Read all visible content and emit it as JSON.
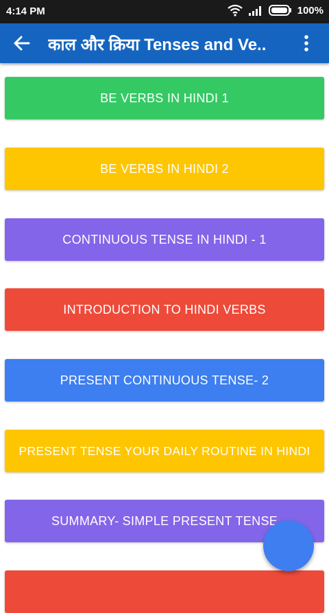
{
  "status": {
    "time": "4:14 PM",
    "battery": "100%"
  },
  "toolbar": {
    "title": "काल और क्रिया Tenses and Ve.."
  },
  "buttons": [
    {
      "label": "BE VERBS IN HINDI 1",
      "color": "#35c964"
    },
    {
      "label": "BE VERBS IN HINDI 2",
      "color": "#fec600"
    },
    {
      "label": "CONTINUOUS TENSE IN HINDI - 1",
      "color": "#8365e9"
    },
    {
      "label": "INTRODUCTION TO HINDI VERBS",
      "color": "#ee4a3a"
    },
    {
      "label": "PRESENT CONTINUOUS TENSE- 2",
      "color": "#3d7ef0"
    },
    {
      "label": "PRESENT TENSE YOUR DAILY ROUTINE IN HINDI",
      "color": "#fec600"
    },
    {
      "label": "SUMMARY- SIMPLE PRESENT TENSE",
      "color": "#8365e9"
    },
    {
      "label": "",
      "color": "#ee4a3a"
    }
  ],
  "icons": {
    "back": "arrow-back-icon",
    "more": "more-vert-icon",
    "wifi": "wifi-icon",
    "signal": "signal-icon",
    "battery": "battery-icon"
  },
  "colors": {
    "toolbar": "#1565c0",
    "statusbar": "#1a1a1a",
    "fab": "#3f7ef0"
  }
}
